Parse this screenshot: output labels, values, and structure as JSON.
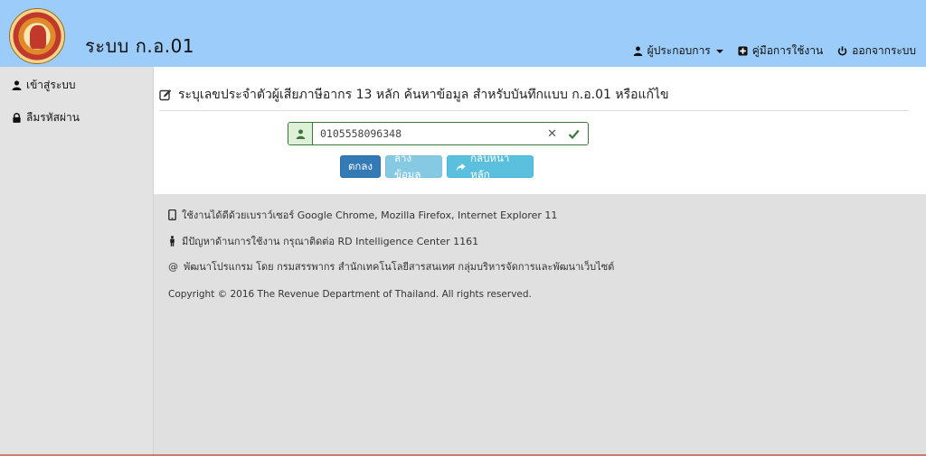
{
  "app": {
    "title": "ระบบ ก.อ.01"
  },
  "top_nav": {
    "operator_label": "ผู้ประกอบการ",
    "manual_label": "คู่มือการใช้งาน",
    "logout_label": "ออกจากระบบ"
  },
  "sidebar": {
    "items": [
      {
        "label": "เข้าสู่ระบบ",
        "icon": "user-icon"
      },
      {
        "label": "ลืมรหัสผ่าน",
        "icon": "lock-icon"
      }
    ]
  },
  "main": {
    "heading": "ระบุเลขประจำตัวผู้เสียภาษีอากร 13 หลัก ค้นหาข้อมูล สำหรับบันทึกแบบ ก.อ.01 หรือแก้ไข",
    "tax_id_value": "0105558096348",
    "buttons": {
      "ok": "ตกลง",
      "clear": "ล้างข้อมูล",
      "home": "กลับหน้าหลัก"
    }
  },
  "footer": {
    "browsers": "ใช้งานได้ดีด้วยเบราว์เซอร์ Google Chrome, Mozilla Firefox, Internet Explorer 11",
    "support": "มีปัญหาด้านการใช้งาน กรุณาติดต่อ RD Intelligence Center 1161",
    "developer_prefix": "@",
    "developer": "พัฒนาโปรแกรม โดย กรมสรรพากร สำนักเทคโนโลยีสารสนเทศ กลุ่มบริหารจัดการและพัฒนาเว็บไซต์",
    "copyright": "Copyright © 2016 The Revenue Department of Thailand. All rights reserved."
  },
  "colors": {
    "header_bg": "#9ccdfa",
    "success_green": "#3c763d",
    "primary_blue": "#337ab7",
    "info_blue": "#5bc0de"
  }
}
